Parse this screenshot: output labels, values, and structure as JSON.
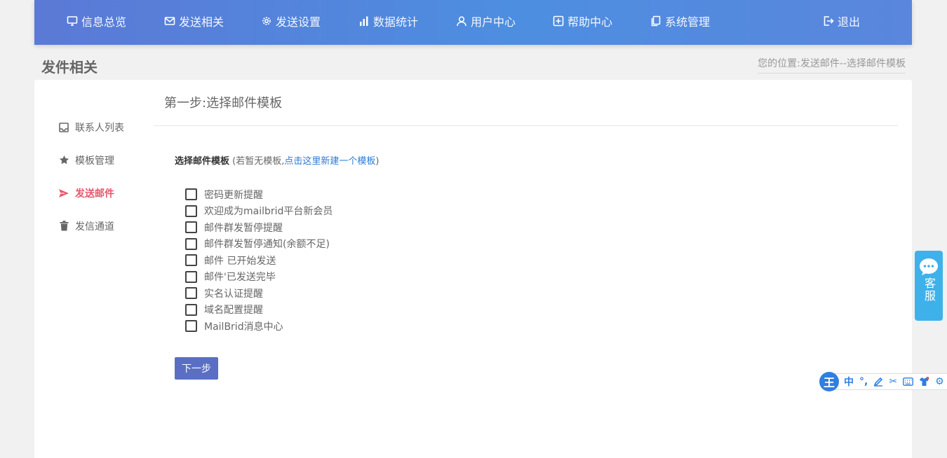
{
  "nav": {
    "items": [
      {
        "label": "信息总览",
        "icon": "monitor-icon"
      },
      {
        "label": "发送相关",
        "icon": "mail-icon"
      },
      {
        "label": "发送设置",
        "icon": "gear-icon"
      },
      {
        "label": "数据统计",
        "icon": "bar-chart-icon"
      },
      {
        "label": "用户中心",
        "icon": "user-icon"
      },
      {
        "label": "帮助中心",
        "icon": "help-icon"
      },
      {
        "label": "系统管理",
        "icon": "copy-icon"
      }
    ],
    "logout": {
      "label": "退出",
      "icon": "logout-icon"
    }
  },
  "page": {
    "title": "发件相关",
    "breadcrumb": "您的位置:发送邮件--选择邮件模板"
  },
  "sidebar": {
    "items": [
      {
        "label": "联系人列表",
        "icon": "inbox-icon"
      },
      {
        "label": "模板管理",
        "icon": "star-icon"
      },
      {
        "label": "发送邮件",
        "icon": "send-icon"
      },
      {
        "label": "发信通道",
        "icon": "trash-icon"
      }
    ]
  },
  "main": {
    "step_title": "第一步:选择邮件模板",
    "tpl_label": "选择邮件模板",
    "tpl_hint_prefix": " (若暂无模板,",
    "tpl_hint_link": "点击这里新建一个模板",
    "tpl_hint_suffix": ")",
    "templates": [
      "密码更新提醒",
      "欢迎成为mailbrid平台新会员",
      "邮件群发暂停提醒",
      "邮件群发暂停通知(余额不足)",
      "邮件 已开始发送",
      "邮件'已发送完毕",
      "实名认证提醒",
      "域名配置提醒",
      "MailBrid消息中心"
    ],
    "next_button": "下一步"
  },
  "customer_service": {
    "label": "客服",
    "icon": "chat-bubble-icon"
  },
  "ime": {
    "logo": "王",
    "mode": "中"
  },
  "colors": {
    "nav_start": "#5b79d6",
    "nav_end": "#4d8ee0",
    "active": "#e8566c",
    "link": "#2a7bd6",
    "button": "#5a6fc4",
    "cs": "#3fb1ea"
  }
}
